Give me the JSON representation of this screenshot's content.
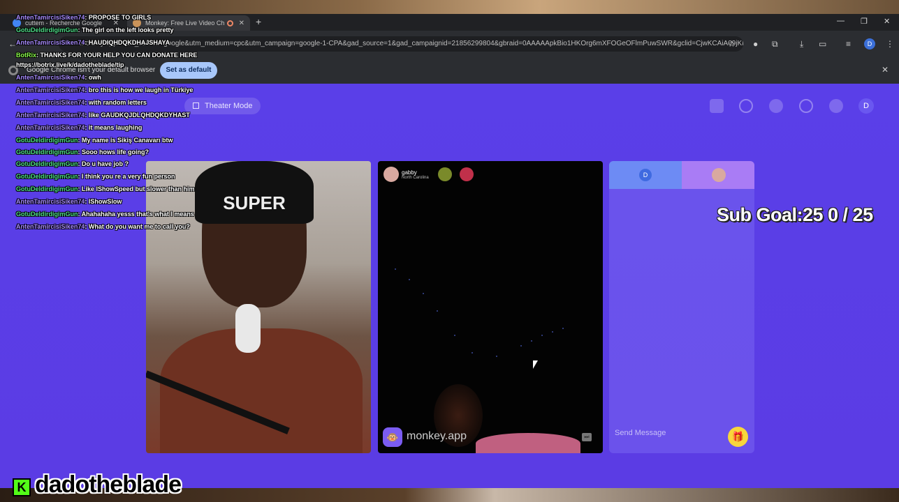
{
  "browser": {
    "tabs": [
      {
        "title": "cuttem - Recherche Google"
      },
      {
        "title": "Monkey: Free Live Video Ch"
      }
    ],
    "new_tab": "+",
    "address": "monkey.app/?utm_source=google&utm_medium=cpc&utm_campaign=google-1-CPA&gad_source=1&gad_campaignid=21856299804&gbraid=0AAAAApkBio1HKOrg6mXFOGeOFlmPuwSWR&gclid=CjwKCAiA09jKBhB9EiwAgB8I-GR2zlSp...",
    "infobar": {
      "message": "Google Chrome isn't your default browser",
      "button": "Set as default",
      "close": "✕"
    },
    "profile": "D"
  },
  "page": {
    "theater_mode": "Theater Mode",
    "nav_profile": "D",
    "partner": {
      "name": "gabby",
      "location": "North Carolina"
    },
    "brand": "monkey.app",
    "chat_tab_user": "D",
    "send_placeholder": "Send Message",
    "sub_goal": "Sub Goal:25  0 / 25"
  },
  "stream_chat": [
    {
      "user": "AntenTamircisiSiken74",
      "text": ": PROPOSE TO GIRLS",
      "color": "purple"
    },
    {
      "user": "GotuDeldirdigimGun",
      "text": ": The girl on the left looks pretty",
      "color": "green"
    },
    {
      "user": "AntenTamircisiSiken74",
      "text": ": HAUDIQHDQKDHAJSHAYA",
      "color": "purple"
    },
    {
      "user": "BotRix",
      "text": ": THANKS FOR YOUR HELP YOU CAN DONATE HERE",
      "color": "lime"
    },
    {
      "user": "",
      "text": "https://botrix.live/k/dadotheblade/tip",
      "color": "none"
    },
    {
      "user": "AntenTamircisiSiken74",
      "text": ": owh",
      "color": "purple"
    },
    {
      "user": "AntenTamircisiSiken74",
      "text": ": bro this is how we laugh in Türkiye",
      "color": "purple"
    },
    {
      "user": "AntenTamircisiSiken74",
      "text": ": with random letters",
      "color": "purple"
    },
    {
      "user": "AntenTamircisiSiken74",
      "text": ": like GAUDKQJDLQHDQKDYHAST",
      "color": "purple"
    },
    {
      "user": "AntenTamircisiSiken74",
      "text": ": it means laughing",
      "color": "purple"
    },
    {
      "user": "GotuDeldirdigimGun",
      "text": ": My name is Sikiş Canavarı btw",
      "color": "green"
    },
    {
      "user": "GotuDeldirdigimGun",
      "text": ": Sooo hows life going?",
      "color": "green"
    },
    {
      "user": "GotuDeldirdigimGun",
      "text": ": Do u have job ?",
      "color": "green"
    },
    {
      "user": "GotuDeldirdigimGun",
      "text": ": I think you re a very fun person",
      "color": "green"
    },
    {
      "user": "GotuDeldirdigimGun",
      "text": ": Like IShowSpeed but slower than him",
      "color": "green"
    },
    {
      "user": "AntenTamircisiSiken74",
      "text": ": IShowSlow",
      "color": "purple"
    },
    {
      "user": "GotuDeldirdigimGun",
      "text": ": Ahahahaha yesss that's what I means",
      "color": "green"
    },
    {
      "user": "AntenTamircisiSiken74",
      "text": ": What do you want me to call you?",
      "color": "purple"
    }
  ],
  "stream": {
    "streamer": "dadotheblade",
    "platform_icon": "K"
  },
  "webcam": {
    "beanie_text": "SUPER"
  }
}
